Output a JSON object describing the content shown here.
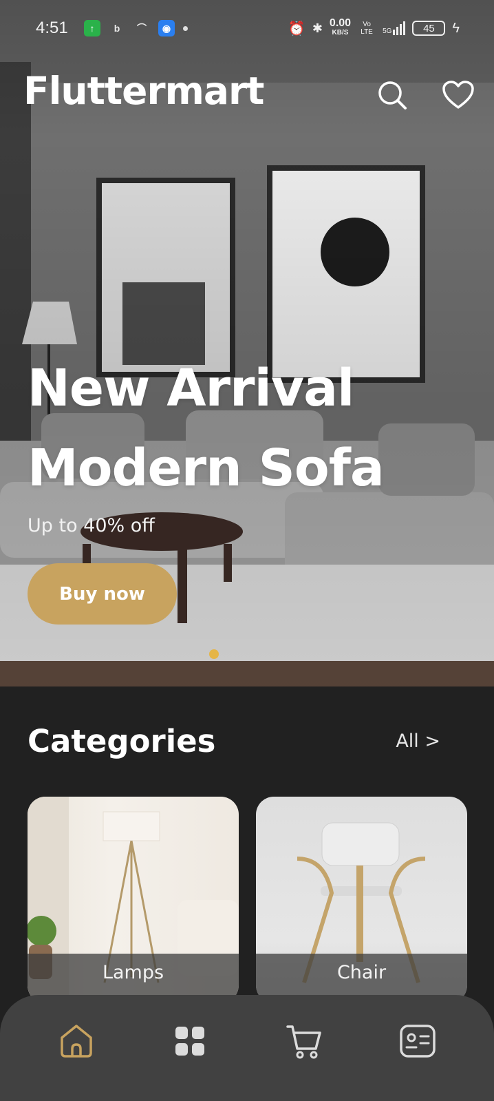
{
  "status_bar": {
    "time": "4:51",
    "net_speed": "0.00",
    "net_unit": "KB/S",
    "volte": "Vo LTE",
    "signal": "5G",
    "battery": "45",
    "icons": [
      "upload-app-icon",
      "bing-icon",
      "missed-call-icon",
      "android-icon",
      "dot-icon",
      "alarm-icon",
      "bluetooth-icon",
      "charging-icon"
    ]
  },
  "app_bar": {
    "title": "Fluttermart",
    "actions": [
      "search-icon",
      "heart-icon"
    ]
  },
  "hero": {
    "heading": "New Arrival\nModern Sofa",
    "subtitle": "Up to 40% off",
    "button_label": "Buy now",
    "accent_color": "#c8a35f",
    "page_indicator": {
      "active": 1,
      "count": 1,
      "color": "#e5b547"
    }
  },
  "categories": {
    "title": "Categories",
    "all_label": "All >",
    "items": [
      {
        "label": "Lamps"
      },
      {
        "label": "Chair"
      }
    ]
  },
  "bottom_nav": {
    "items": [
      {
        "name": "home",
        "icon": "home-icon",
        "active": true
      },
      {
        "name": "categories",
        "icon": "grid-icon",
        "active": false
      },
      {
        "name": "cart",
        "icon": "cart-icon",
        "active": false
      },
      {
        "name": "profile",
        "icon": "id-card-icon",
        "active": false
      }
    ],
    "active_color": "#c8a35f",
    "inactive_color": "#dcdcdc"
  }
}
